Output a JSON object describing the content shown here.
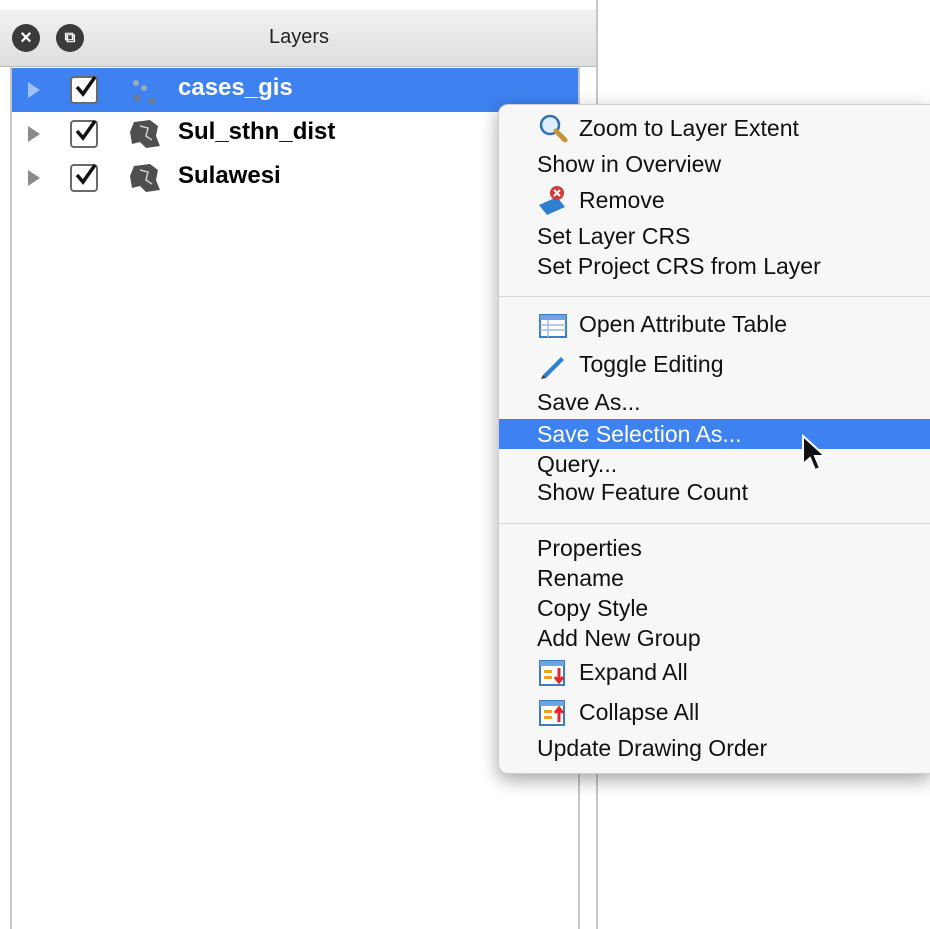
{
  "panel": {
    "title": "Layers",
    "close_icon": "close-icon",
    "float_icon": "float-icon"
  },
  "layers": [
    {
      "name": "cases_gis",
      "checked": true,
      "selected": true,
      "icon": "point-layer-icon"
    },
    {
      "name": "Sul_sthn_dist",
      "checked": true,
      "selected": false,
      "icon": "polygon-layer-icon"
    },
    {
      "name": "Sulawesi",
      "checked": true,
      "selected": false,
      "icon": "polygon-layer-icon"
    }
  ],
  "context_menu": {
    "items": [
      {
        "label": "Zoom to Layer Extent",
        "icon": "zoom-icon"
      },
      {
        "label": "Show in Overview"
      },
      {
        "label": "Remove",
        "icon": "remove-icon"
      },
      {
        "label": "Set Layer CRS"
      },
      {
        "label": "Set Project CRS from Layer"
      },
      {
        "label": "Open Attribute Table",
        "icon": "table-icon"
      },
      {
        "label": "Toggle Editing",
        "icon": "pencil-icon"
      },
      {
        "label": "Save As..."
      },
      {
        "label": "Save Selection As...",
        "highlighted": true
      },
      {
        "label": "Query..."
      },
      {
        "label": "Show Feature Count"
      },
      {
        "label": "Properties"
      },
      {
        "label": "Rename"
      },
      {
        "label": "Copy Style"
      },
      {
        "label": "Add New Group"
      },
      {
        "label": "Expand All",
        "icon": "expand-all-icon"
      },
      {
        "label": "Collapse All",
        "icon": "collapse-all-icon"
      },
      {
        "label": "Update Drawing Order"
      }
    ]
  },
  "colors": {
    "selection": "#3d82f0"
  }
}
